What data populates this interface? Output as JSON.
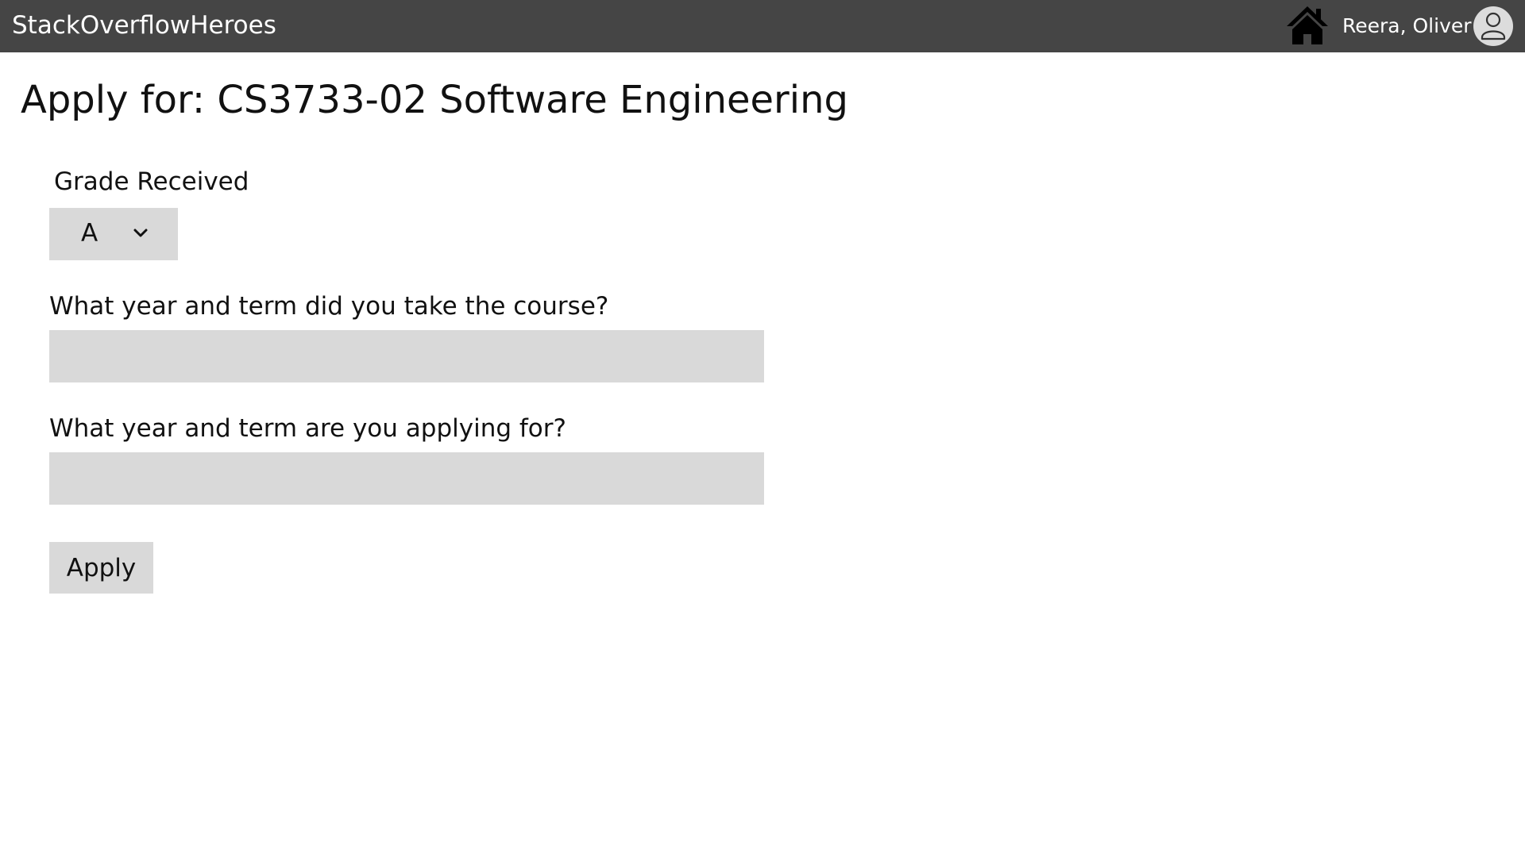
{
  "header": {
    "brand": "StackOverflowHeroes",
    "user_name": "Reera, Oliver",
    "home_icon": "home-icon",
    "avatar_icon": "user-avatar-icon",
    "background_color": "#454545",
    "text_color": "#ffffff"
  },
  "page": {
    "title": "Apply for: CS3733-02 Software Engineering"
  },
  "form": {
    "grade_label": "Grade Received",
    "grade_value": "A",
    "grade_chevron_icon": "chevron-down-icon",
    "course_term_label": "What year and term did you take the course?",
    "course_term_value": "",
    "applying_term_label": "What year and term are you applying for?",
    "applying_term_value": "",
    "field_color": "#d9d9d9"
  },
  "actions": {
    "apply_label": "Apply"
  }
}
